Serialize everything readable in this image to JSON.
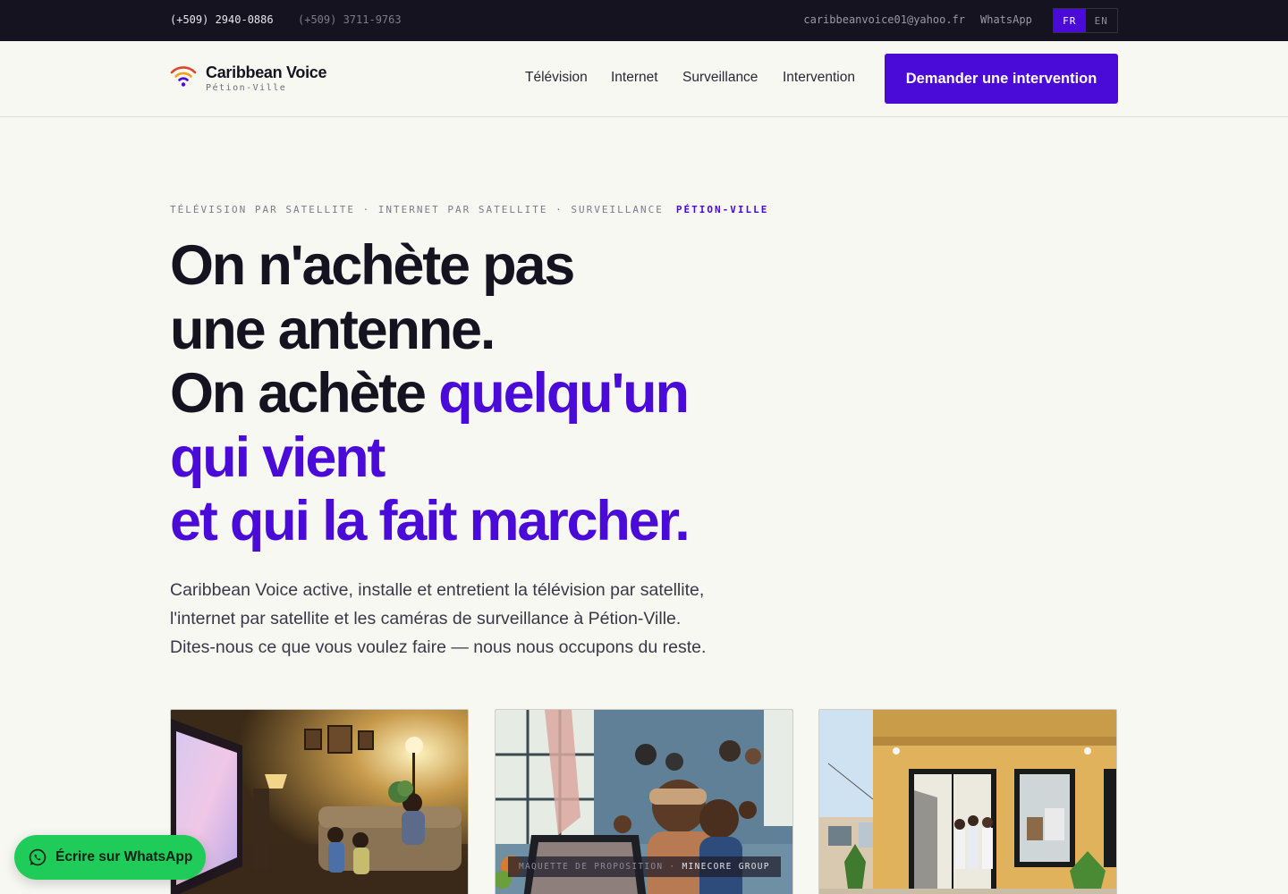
{
  "topbar": {
    "phone_primary": "(+509) 2940-0886",
    "phone_secondary": "(+509) 3711-9763",
    "email": "caribbeanvoice01@yahoo.fr",
    "whatsapp": "WhatsApp",
    "languages": {
      "fr": "FR",
      "en": "EN",
      "active": "FR"
    }
  },
  "header": {
    "brand": "Caribbean Voice",
    "location": "Pétion-Ville",
    "nav": [
      "Télévision",
      "Internet",
      "Surveillance",
      "Intervention"
    ],
    "cta": "Demander une intervention"
  },
  "hero": {
    "eyebrow": "TÉLÉVISION PAR SATELLITE · INTERNET PAR SATELLITE · SURVEILLANCE",
    "eyebrow_city": "PÉTION-VILLE",
    "headline": {
      "line1": "On n'achète pas",
      "line2": "une antenne.",
      "line3_plain": "On achète ",
      "line3_accent": "quelqu'un",
      "line4": "qui vient",
      "line5": "et qui la fait marcher."
    },
    "lead": {
      "line1": "Caribbean Voice active, installe et entretient la télévision par satellite,",
      "line2": "l'internet par satellite et les caméras de surveillance à Pétion-Ville.",
      "line3": "Dites-nous ce que vous voulez faire — nous nous occupons du reste."
    }
  },
  "cards": {
    "badge_prefix": "MAQUETTE DE PROPOSITION ·",
    "badge_brand": "MINECORE GROUP"
  },
  "floating_whatsapp": {
    "label": "Écrire sur WhatsApp"
  },
  "colors": {
    "accent": "#4a0ad8",
    "dark": "#15131f",
    "background": "#f8f8f3",
    "whatsapp_green": "#1fcc5a"
  }
}
